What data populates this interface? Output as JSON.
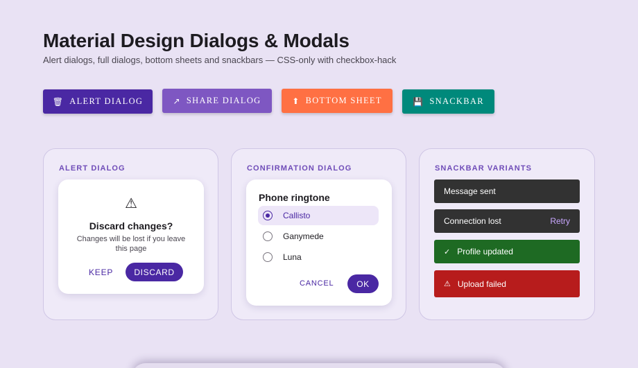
{
  "header": {
    "title": "Material Design Dialogs & Modals",
    "subtitle": "Alert dialogs, full dialogs, bottom sheets and snackbars — CSS-only with checkbox-hack"
  },
  "triggers": [
    {
      "icon": "trash-icon",
      "glyph": "🗑",
      "label": "ALERT DIALOG",
      "color": "#4a28a3"
    },
    {
      "icon": "share-arrow-icon",
      "glyph": "↗",
      "label": "SHARE DIALOG",
      "color": "#7e57c2"
    },
    {
      "icon": "upload-arrow-icon",
      "glyph": "⬆",
      "label": "BOTTOM SHEET",
      "color": "#ff7043"
    },
    {
      "icon": "floppy-disk-icon",
      "glyph": "💾",
      "label": "SNACKBAR",
      "color": "#00897b"
    }
  ],
  "alert_card": {
    "label": "ALERT DIALOG",
    "dialog": {
      "icon": "warning-icon",
      "glyph": "⚠",
      "title": "Discard changes?",
      "body": "Changes will be lost if you leave this page",
      "keep_label": "KEEP",
      "discard_label": "DISCARD"
    }
  },
  "confirm_card": {
    "label": "CONFIRMATION DIALOG",
    "dialog": {
      "title": "Phone ringtone",
      "options": [
        {
          "label": "Callisto",
          "selected": true
        },
        {
          "label": "Ganymede",
          "selected": false
        },
        {
          "label": "Luna",
          "selected": false
        }
      ],
      "cancel_label": "CANCEL",
      "ok_label": "OK"
    }
  },
  "snack_card": {
    "label": "SNACKBAR VARIANTS",
    "snackbars": [
      {
        "text": "Message sent",
        "color": "#323232"
      },
      {
        "text": "Connection lost",
        "action": "Retry",
        "color": "#323232"
      },
      {
        "icon": "check-icon",
        "glyph": "✓",
        "text": "Profile updated",
        "color": "#1e6a23"
      },
      {
        "icon": "warning-icon",
        "glyph": "⚠",
        "text": "Upload failed",
        "color": "#b71c1c"
      }
    ]
  },
  "colors": {
    "background": "#e9e2f4",
    "primary": "#4a28a3",
    "card_label": "#6f4cb8"
  }
}
